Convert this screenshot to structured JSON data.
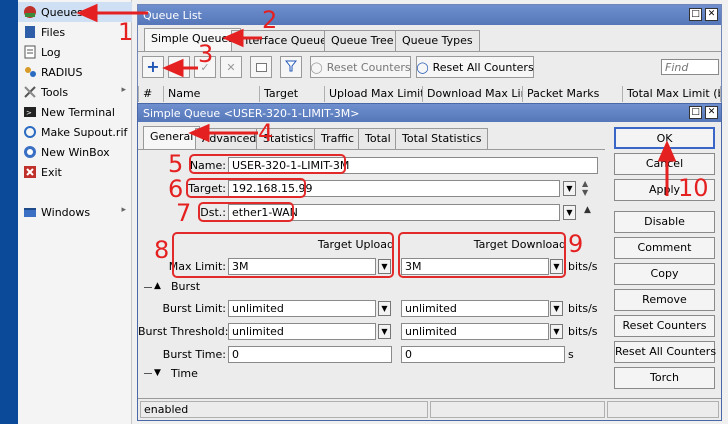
{
  "colors": {
    "accent_red": "#e42020",
    "titlebar": "#5f80c2",
    "menu_selected": "#cfe0f5"
  },
  "menu": {
    "items": [
      {
        "label": "Queues",
        "icon": "queues-icon",
        "arrow": ""
      },
      {
        "label": "Files",
        "icon": "files-icon",
        "arrow": ""
      },
      {
        "label": "Log",
        "icon": "log-icon",
        "arrow": ""
      },
      {
        "label": "RADIUS",
        "icon": "radius-icon",
        "arrow": ""
      },
      {
        "label": "Tools",
        "icon": "tools-icon",
        "arrow": "▸"
      },
      {
        "label": "New Terminal",
        "icon": "terminal-icon",
        "arrow": ""
      },
      {
        "label": "Make Supout.rif",
        "icon": "supout-icon",
        "arrow": ""
      },
      {
        "label": "New WinBox",
        "icon": "winbox-icon",
        "arrow": ""
      },
      {
        "label": "Exit",
        "icon": "exit-icon",
        "arrow": ""
      },
      {
        "label": "Windows",
        "icon": "windows-icon",
        "arrow": "▸"
      }
    ]
  },
  "queue_list": {
    "title": "Queue List",
    "tabs": [
      "Simple Queues",
      "Interface Queues",
      "Queue Tree",
      "Queue Types"
    ],
    "toolbar": {
      "reset_counters": "Reset Counters",
      "reset_all_counters": "Reset All Counters",
      "find_placeholder": "Find"
    },
    "columns": [
      "#",
      "Name",
      "Target",
      "Upload Max Limit",
      "Download Max Limit",
      "Packet Marks",
      "Total Max Limit (b"
    ]
  },
  "simple_queue": {
    "title": "Simple Queue <USER-320-1-LIMIT-3M>",
    "tabs": [
      "General",
      "Advanced",
      "Statistics",
      "Traffic",
      "Total",
      "Total Statistics"
    ],
    "name_label": "Name:",
    "name_value": "USER-320-1-LIMIT-3M",
    "target_label": "Target:",
    "target_value": "192.168.15.99",
    "dst_label": "Dst.:",
    "dst_value": "ether1-WAN",
    "target_upload_label": "Target Upload",
    "target_download_label": "Target Download",
    "max_limit_label": "Max Limit:",
    "max_limit_upload": "3M",
    "max_limit_download": "3M",
    "unit_bits": "bits/s",
    "unit_s": "s",
    "burst_section": "Burst",
    "burst_limit_label": "Burst Limit:",
    "burst_limit_upload": "unlimited",
    "burst_limit_download": "unlimited",
    "burst_threshold_label": "Burst Threshold:",
    "burst_threshold_upload": "unlimited",
    "burst_threshold_download": "unlimited",
    "burst_time_label": "Burst Time:",
    "burst_time_upload": "0",
    "burst_time_download": "0",
    "time_section": "Time",
    "status": "enabled",
    "buttons": [
      "OK",
      "Cancel",
      "Apply",
      "Disable",
      "Comment",
      "Copy",
      "Remove",
      "Reset Counters",
      "Reset All Counters",
      "Torch"
    ]
  },
  "annotations": [
    "1",
    "2",
    "3",
    "4",
    "5",
    "6",
    "7",
    "8",
    "9",
    "10"
  ]
}
